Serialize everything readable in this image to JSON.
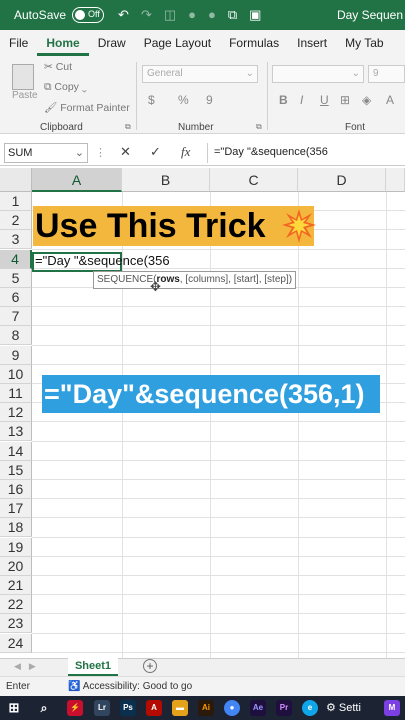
{
  "titlebar": {
    "autosave_label": "AutoSave",
    "autosave_state": "Off",
    "doc_title": "Day Sequen"
  },
  "ribbon_tabs": [
    "File",
    "Home",
    "Draw",
    "Page Layout",
    "Formulas",
    "Insert",
    "My Tab"
  ],
  "ribbon": {
    "paste_label": "Paste",
    "cut_label": "Cut",
    "copy_label": "Copy",
    "format_painter_label": "Format Painter",
    "clipboard_label": "Clipboard",
    "number_format": "General",
    "number_label": "Number",
    "font_size": "9",
    "font_label": "Font",
    "number_symbols": [
      "$",
      "%",
      "9"
    ],
    "font_buttons": [
      "B",
      "I",
      "U"
    ]
  },
  "formula_bar": {
    "name_box": "SUM",
    "cancel_symbol": "✕",
    "enter_symbol": "✓",
    "fx_symbol": "fx",
    "formula": "=\"Day \"&sequence(356"
  },
  "grid": {
    "columns": [
      "A",
      "B",
      "C",
      "D"
    ],
    "rows": [
      "1",
      "2",
      "3",
      "4",
      "5",
      "6",
      "7",
      "8",
      "9",
      "10",
      "11",
      "12",
      "13",
      "14",
      "15",
      "16",
      "17",
      "18",
      "19",
      "20",
      "21",
      "22",
      "23",
      "24"
    ],
    "selected_column": "A",
    "selected_row": "4",
    "active_cell_text": "=\"Day \"&sequence(356",
    "tooltip": {
      "fn": "SEQUENCE(",
      "arg_bold": "rows",
      "rest": ", [columns], [start], [step])"
    }
  },
  "overlays": {
    "headline": "Use This Trick",
    "headline_color": "#f4b73e",
    "formula_banner": "=\"Day\"&sequence(356,1)",
    "formula_banner_color": "#2f9fdf"
  },
  "sheets": {
    "active": "Sheet1"
  },
  "statusbar": {
    "mode": "Enter",
    "accessibility": "Accessibility: Good to go"
  },
  "taskbar": {
    "settings_label": "Setti"
  },
  "colors": {
    "excel_green": "#217346"
  }
}
